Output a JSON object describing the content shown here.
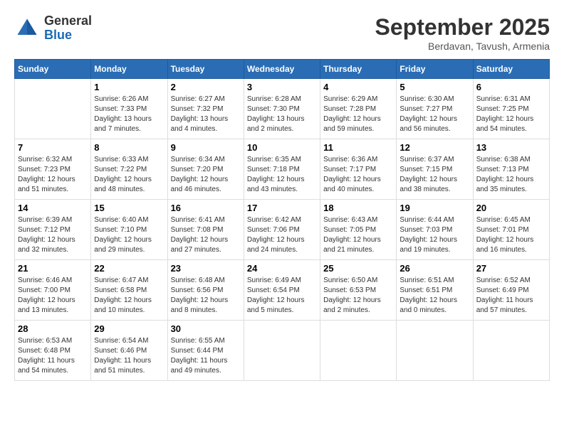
{
  "logo": {
    "general": "General",
    "blue": "Blue"
  },
  "header": {
    "month": "September 2025",
    "location": "Berdavan, Tavush, Armenia"
  },
  "days_of_week": [
    "Sunday",
    "Monday",
    "Tuesday",
    "Wednesday",
    "Thursday",
    "Friday",
    "Saturday"
  ],
  "weeks": [
    [
      {
        "day": "",
        "info": ""
      },
      {
        "day": "1",
        "info": "Sunrise: 6:26 AM\nSunset: 7:33 PM\nDaylight: 13 hours\nand 7 minutes."
      },
      {
        "day": "2",
        "info": "Sunrise: 6:27 AM\nSunset: 7:32 PM\nDaylight: 13 hours\nand 4 minutes."
      },
      {
        "day": "3",
        "info": "Sunrise: 6:28 AM\nSunset: 7:30 PM\nDaylight: 13 hours\nand 2 minutes."
      },
      {
        "day": "4",
        "info": "Sunrise: 6:29 AM\nSunset: 7:28 PM\nDaylight: 12 hours\nand 59 minutes."
      },
      {
        "day": "5",
        "info": "Sunrise: 6:30 AM\nSunset: 7:27 PM\nDaylight: 12 hours\nand 56 minutes."
      },
      {
        "day": "6",
        "info": "Sunrise: 6:31 AM\nSunset: 7:25 PM\nDaylight: 12 hours\nand 54 minutes."
      }
    ],
    [
      {
        "day": "7",
        "info": "Sunrise: 6:32 AM\nSunset: 7:23 PM\nDaylight: 12 hours\nand 51 minutes."
      },
      {
        "day": "8",
        "info": "Sunrise: 6:33 AM\nSunset: 7:22 PM\nDaylight: 12 hours\nand 48 minutes."
      },
      {
        "day": "9",
        "info": "Sunrise: 6:34 AM\nSunset: 7:20 PM\nDaylight: 12 hours\nand 46 minutes."
      },
      {
        "day": "10",
        "info": "Sunrise: 6:35 AM\nSunset: 7:18 PM\nDaylight: 12 hours\nand 43 minutes."
      },
      {
        "day": "11",
        "info": "Sunrise: 6:36 AM\nSunset: 7:17 PM\nDaylight: 12 hours\nand 40 minutes."
      },
      {
        "day": "12",
        "info": "Sunrise: 6:37 AM\nSunset: 7:15 PM\nDaylight: 12 hours\nand 38 minutes."
      },
      {
        "day": "13",
        "info": "Sunrise: 6:38 AM\nSunset: 7:13 PM\nDaylight: 12 hours\nand 35 minutes."
      }
    ],
    [
      {
        "day": "14",
        "info": "Sunrise: 6:39 AM\nSunset: 7:12 PM\nDaylight: 12 hours\nand 32 minutes."
      },
      {
        "day": "15",
        "info": "Sunrise: 6:40 AM\nSunset: 7:10 PM\nDaylight: 12 hours\nand 29 minutes."
      },
      {
        "day": "16",
        "info": "Sunrise: 6:41 AM\nSunset: 7:08 PM\nDaylight: 12 hours\nand 27 minutes."
      },
      {
        "day": "17",
        "info": "Sunrise: 6:42 AM\nSunset: 7:06 PM\nDaylight: 12 hours\nand 24 minutes."
      },
      {
        "day": "18",
        "info": "Sunrise: 6:43 AM\nSunset: 7:05 PM\nDaylight: 12 hours\nand 21 minutes."
      },
      {
        "day": "19",
        "info": "Sunrise: 6:44 AM\nSunset: 7:03 PM\nDaylight: 12 hours\nand 19 minutes."
      },
      {
        "day": "20",
        "info": "Sunrise: 6:45 AM\nSunset: 7:01 PM\nDaylight: 12 hours\nand 16 minutes."
      }
    ],
    [
      {
        "day": "21",
        "info": "Sunrise: 6:46 AM\nSunset: 7:00 PM\nDaylight: 12 hours\nand 13 minutes."
      },
      {
        "day": "22",
        "info": "Sunrise: 6:47 AM\nSunset: 6:58 PM\nDaylight: 12 hours\nand 10 minutes."
      },
      {
        "day": "23",
        "info": "Sunrise: 6:48 AM\nSunset: 6:56 PM\nDaylight: 12 hours\nand 8 minutes."
      },
      {
        "day": "24",
        "info": "Sunrise: 6:49 AM\nSunset: 6:54 PM\nDaylight: 12 hours\nand 5 minutes."
      },
      {
        "day": "25",
        "info": "Sunrise: 6:50 AM\nSunset: 6:53 PM\nDaylight: 12 hours\nand 2 minutes."
      },
      {
        "day": "26",
        "info": "Sunrise: 6:51 AM\nSunset: 6:51 PM\nDaylight: 12 hours\nand 0 minutes."
      },
      {
        "day": "27",
        "info": "Sunrise: 6:52 AM\nSunset: 6:49 PM\nDaylight: 11 hours\nand 57 minutes."
      }
    ],
    [
      {
        "day": "28",
        "info": "Sunrise: 6:53 AM\nSunset: 6:48 PM\nDaylight: 11 hours\nand 54 minutes."
      },
      {
        "day": "29",
        "info": "Sunrise: 6:54 AM\nSunset: 6:46 PM\nDaylight: 11 hours\nand 51 minutes."
      },
      {
        "day": "30",
        "info": "Sunrise: 6:55 AM\nSunset: 6:44 PM\nDaylight: 11 hours\nand 49 minutes."
      },
      {
        "day": "",
        "info": ""
      },
      {
        "day": "",
        "info": ""
      },
      {
        "day": "",
        "info": ""
      },
      {
        "day": "",
        "info": ""
      }
    ]
  ]
}
